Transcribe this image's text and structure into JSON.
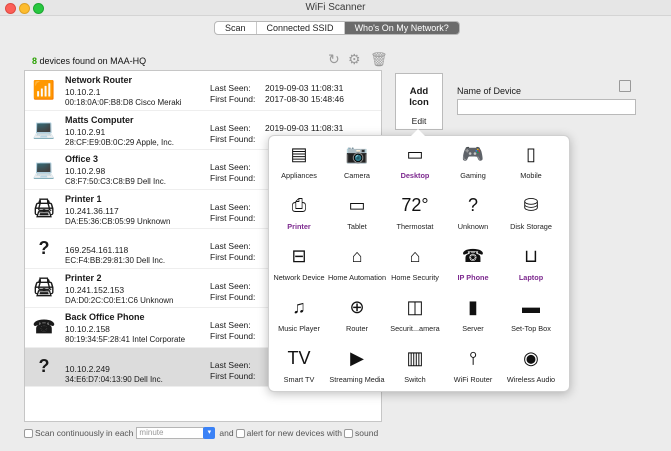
{
  "window": {
    "title": "WiFi Scanner"
  },
  "tabs": [
    {
      "label": "Scan",
      "active": false
    },
    {
      "label": "Connected SSID",
      "active": false
    },
    {
      "label": "Who's On My Network?",
      "active": true
    }
  ],
  "device_count": {
    "number": "8",
    "text": "devices found on MAA-HQ"
  },
  "labels": {
    "last_seen": "Last Seen:",
    "first_found": "First Found:"
  },
  "devices": [
    {
      "name": "Network Router",
      "ip": "10.10.2.1",
      "mac": "00:18:0A:0F:B8:D8 Cisco Meraki",
      "last_seen": "2019-09-03 11:08:31",
      "first_found": "2017-08-30 15:48:46",
      "icon": "router-icon"
    },
    {
      "name": "Matts Computer",
      "ip": "10.10.2.91",
      "mac": "28:CF:E9:0B:0C:29 Apple, Inc.",
      "last_seen": "2019-09-03 11:08:31",
      "first_found": "",
      "icon": "laptop-icon"
    },
    {
      "name": "Office 3",
      "ip": "10.10.2.98",
      "mac": "C8:F7:50:C3:C8:B9 Dell Inc.",
      "last_seen": "",
      "first_found": "",
      "icon": "laptop-icon"
    },
    {
      "name": "Printer 1",
      "ip": "10.241.36.117",
      "mac": "DA:E5:36:CB:05:99 Unknown",
      "last_seen": "",
      "first_found": "",
      "icon": "printer-icon"
    },
    {
      "name": "",
      "ip": "169.254.161.118",
      "mac": "EC:F4:BB:29:81:30 Dell Inc.",
      "last_seen": "",
      "first_found": "",
      "icon": "question-icon"
    },
    {
      "name": "Printer 2",
      "ip": "10.241.152.153",
      "mac": "DA:D0:2C:C0:E1:C6 Unknown",
      "last_seen": "",
      "first_found": "",
      "icon": "printer-icon"
    },
    {
      "name": "Back Office Phone",
      "ip": "10.10.2.158",
      "mac": "80:19:34:5F:28:41 Intel Corporate",
      "last_seen": "",
      "first_found": "",
      "icon": "phone-icon"
    },
    {
      "name": "",
      "ip": "10.10.2.249",
      "mac": "34:E6:D7:04:13:90 Dell Inc.",
      "last_seen": "",
      "first_found": "",
      "icon": "question-icon"
    }
  ],
  "bottom": {
    "scan_continuously": "Scan continuously",
    "in_each": "in each",
    "interval_placeholder": "minute",
    "and": "and",
    "alert": "alert for new devices with",
    "sound": "sound"
  },
  "add_icon": {
    "title_line1": "Add",
    "title_line2": "Icon",
    "edit": "Edit"
  },
  "name_of_device": {
    "label": "Name of Device",
    "value": ""
  },
  "icon_picker": [
    {
      "label": "Appliances",
      "glyph": "▤",
      "highlight": false
    },
    {
      "label": "Camera",
      "glyph": "📷",
      "highlight": false
    },
    {
      "label": "Desktop",
      "glyph": "▭",
      "highlight": true
    },
    {
      "label": "Gaming",
      "glyph": "🎮",
      "highlight": false
    },
    {
      "label": "Mobile",
      "glyph": "▯",
      "highlight": false
    },
    {
      "label": "Printer",
      "glyph": "⎙",
      "highlight": true
    },
    {
      "label": "Tablet",
      "glyph": "▭",
      "highlight": false
    },
    {
      "label": "Thermostat",
      "glyph": "72°",
      "highlight": false
    },
    {
      "label": "Unknown",
      "glyph": "?",
      "highlight": false
    },
    {
      "label": "Disk Storage",
      "glyph": "⛁",
      "highlight": false
    },
    {
      "label": "Network Device",
      "glyph": "⊟",
      "highlight": false
    },
    {
      "label": "Home Automation",
      "glyph": "⌂",
      "highlight": false
    },
    {
      "label": "Home Security",
      "glyph": "⌂",
      "highlight": false
    },
    {
      "label": "IP Phone",
      "glyph": "☎",
      "highlight": true
    },
    {
      "label": "Laptop",
      "glyph": "⊔",
      "highlight": true
    },
    {
      "label": "Music Player",
      "glyph": "♫",
      "highlight": false
    },
    {
      "label": "Router",
      "glyph": "⊕",
      "highlight": false
    },
    {
      "label": "Securit...amera",
      "glyph": "◫",
      "highlight": false
    },
    {
      "label": "Server",
      "glyph": "▮",
      "highlight": false
    },
    {
      "label": "Set-Top Box",
      "glyph": "▬",
      "highlight": false
    },
    {
      "label": "Smart TV",
      "glyph": "TV",
      "highlight": false
    },
    {
      "label": "Streaming Media",
      "glyph": "▶",
      "highlight": false
    },
    {
      "label": "Switch",
      "glyph": "▥",
      "highlight": false
    },
    {
      "label": "WiFi Router",
      "glyph": "⫯",
      "highlight": false
    },
    {
      "label": "Wireless Audio",
      "glyph": "◉",
      "highlight": false
    }
  ]
}
